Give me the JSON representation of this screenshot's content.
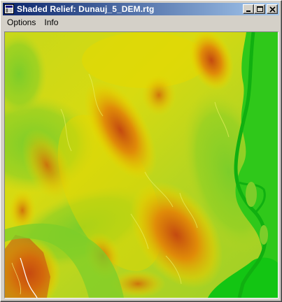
{
  "window": {
    "title": "Shaded Relief:  Dunauj_5_DEM.rtg",
    "controls": [
      "minimize-icon",
      "maximize-icon",
      "close-icon"
    ]
  },
  "menubar": {
    "items": [
      {
        "label": "Options"
      },
      {
        "label": "Info"
      }
    ]
  },
  "relief_map": {
    "icon": "shaded-relief-map",
    "colors": {
      "lowland_green": "#2fc81a",
      "low_green": "#7ccd2a",
      "mid_yellowgreen": "#b7d520",
      "high_yellow": "#e5d800",
      "higher_orange": "#e29a00",
      "peak_red": "#c84a10",
      "river_green": "#13c513"
    }
  }
}
